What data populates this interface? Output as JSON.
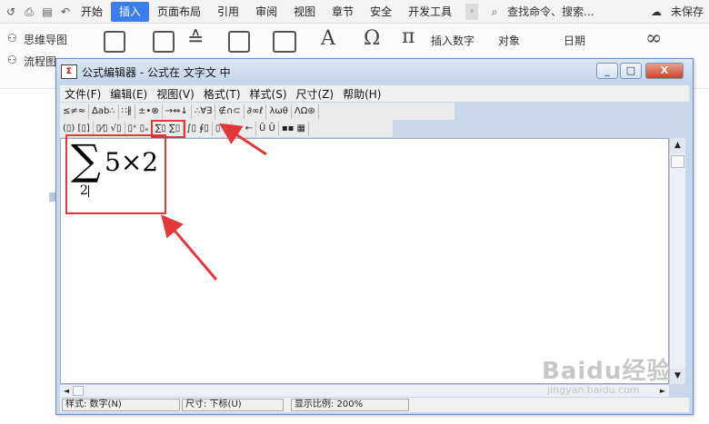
{
  "ribbon": {
    "tabs": [
      "开始",
      "插入",
      "页面布局",
      "引用",
      "审阅",
      "视图",
      "章节",
      "安全",
      "开发工具"
    ],
    "active_tab": "插入",
    "search_text": "查找命令、搜索...",
    "save_status": "未保存",
    "left_items": [
      "思维导图",
      "流程图"
    ],
    "insert_items": [
      "插入数字",
      "对象",
      "日期"
    ]
  },
  "window": {
    "title": "公式编辑器 - 公式在 文字文 中",
    "buttons": {
      "minimize": "_",
      "maximize": "□",
      "close": "X"
    },
    "menu": [
      "文件(F)",
      "编辑(E)",
      "视图(V)",
      "格式(T)",
      "样式(S)",
      "尺寸(Z)",
      "帮助(H)"
    ],
    "toolbar_row1": [
      "≤≠≈",
      "∆ab∴",
      "∷∦",
      "±•⊗",
      "→⇔↓",
      "∴∀∃",
      "∉∩⊂",
      "∂∞ℓ",
      "λωθ",
      "ΛΩ⊛"
    ],
    "toolbar_row2": [
      "(▯) [▯]",
      "▯⁄▯ √▯",
      "▯ˣ ▯ₓ",
      "∑▯ ∑▯",
      "∫▯ ∮▯",
      "▯ ▯",
      "→ ←",
      "Ū Û",
      "▪▪ ▦"
    ],
    "highlighted_tool": "∑▯ ∑▯",
    "formula": {
      "operator": "∑",
      "body": "5×2",
      "lower_limit": "2"
    },
    "status": {
      "style": "样式: 数字(N)",
      "size": "尺寸: 下标(U)",
      "zoom": "显示比例: 200%"
    }
  },
  "watermark": {
    "main": "Baidu经验",
    "sub": "jingyan.baidu.com"
  },
  "colors": {
    "annotation_red": "#e2383a",
    "tab_active_blue": "#3b7de9",
    "window_frame": "#c9d7eb"
  }
}
